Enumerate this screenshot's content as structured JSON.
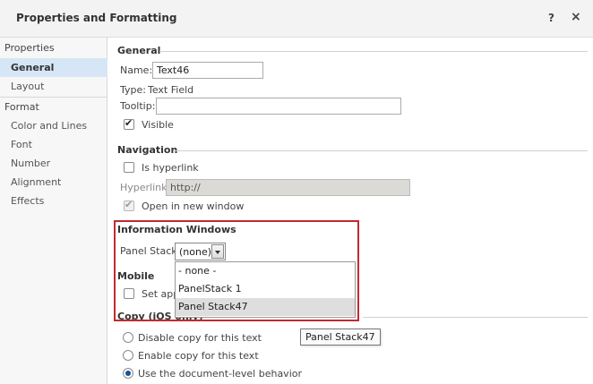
{
  "window": {
    "title": "Properties and Formatting",
    "help_label": "?",
    "close_label": "×"
  },
  "sidebar": {
    "section1": "Properties",
    "items1": [
      {
        "label": "General",
        "selected": true
      },
      {
        "label": "Layout",
        "selected": false
      }
    ],
    "section2": "Format",
    "items2": [
      {
        "label": "Color and Lines"
      },
      {
        "label": "Font"
      },
      {
        "label": "Number"
      },
      {
        "label": "Alignment"
      },
      {
        "label": "Effects"
      }
    ]
  },
  "general": {
    "title": "General",
    "name_label": "Name:",
    "name_value": "Text46",
    "type_label": "Type:",
    "type_value": "Text Field",
    "tooltip_label": "Tooltip:",
    "tooltip_value": "",
    "visible_label": "Visible",
    "visible_checked": true
  },
  "navigation": {
    "title": "Navigation",
    "is_hyperlink_label": "Is hyperlink",
    "hyperlink_label": "Hyperlink:",
    "hyperlink_value": "http://",
    "open_new_window_label": "Open in new window"
  },
  "info_windows": {
    "title": "Information Windows",
    "panel_stack_label": "Panel Stack:",
    "panel_stack_value": "(none)",
    "options": [
      "- none -",
      "PanelStack 1",
      "Panel Stack47"
    ],
    "hovered_option": "Panel Stack47"
  },
  "mobile": {
    "title": "Mobile",
    "set_app_label": "Set app"
  },
  "copy": {
    "title": "Copy (iOS only)",
    "options": [
      "Disable copy for this text",
      "Enable copy for this text",
      "Use the document-level behavior"
    ],
    "selected_index": 2
  },
  "tooltip_popup": "Panel Stack47",
  "colors": {
    "highlight": "#c22a2f",
    "selected_sidebar": "#d6e6f7"
  }
}
